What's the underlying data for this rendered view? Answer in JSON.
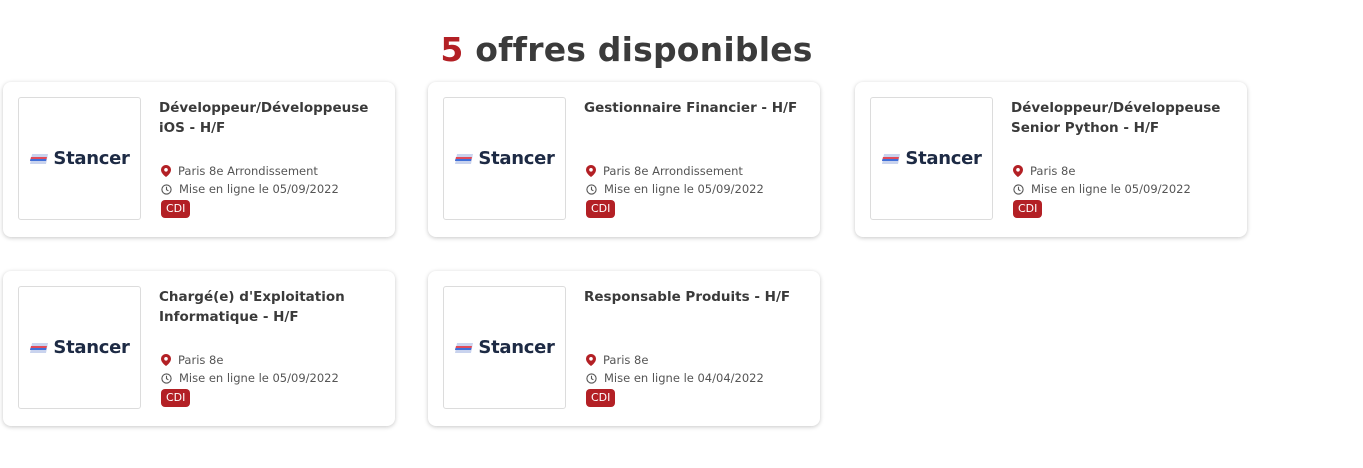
{
  "header": {
    "count": "5",
    "text": "offres disponibles",
    "count_color": "#b32025"
  },
  "company": {
    "name": "Stancer",
    "logo_icon": "stancer-logo-icon"
  },
  "jobs": [
    {
      "title": "Développeur/Développeuse iOS - H/F",
      "location": "Paris 8e Arrondissement",
      "posted": "Mise en ligne le 05/09/2022",
      "contract": "CDI"
    },
    {
      "title": "Gestionnaire Financier - H/F",
      "location": "Paris 8e Arrondissement",
      "posted": "Mise en ligne le 05/09/2022",
      "contract": "CDI"
    },
    {
      "title": "Développeur/Développeuse Senior Python - H/F",
      "location": "Paris 8e",
      "posted": "Mise en ligne le 05/09/2022",
      "contract": "CDI"
    },
    {
      "title": "Chargé(e) d'Exploitation Informatique - H/F",
      "location": "Paris 8e",
      "posted": "Mise en ligne le 05/09/2022",
      "contract": "CDI"
    },
    {
      "title": "Responsable Produits - H/F",
      "location": "Paris 8e",
      "posted": "Mise en ligne le 04/04/2022",
      "contract": "CDI"
    }
  ],
  "icons": {
    "location": "map-pin-icon",
    "date": "clock-icon"
  },
  "colors": {
    "accent": "#b32025",
    "text": "#3a3a3a",
    "logo_text": "#1d2a44"
  }
}
